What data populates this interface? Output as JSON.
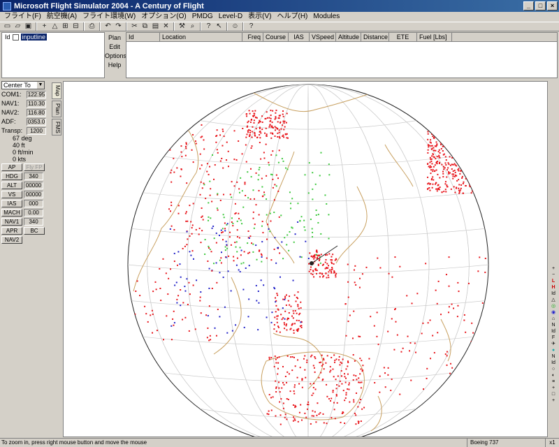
{
  "window": {
    "title": "Microsoft Flight Simulator 2004 - A Century of Flight",
    "min": "_",
    "max": "□",
    "close": "×"
  },
  "menu": [
    "フライト(F)",
    "航空機(A)",
    "フライト環境(W)",
    "オプション(O)",
    "PMDG",
    "Level-D",
    "表示(V)",
    "ヘルプ(H)",
    "Modules"
  ],
  "toplist": {
    "id_label": "Id",
    "input_value": "inputline"
  },
  "planmenu": [
    "Plan",
    "Edit",
    "Options",
    "Help"
  ],
  "flightplan": {
    "columns": [
      "Id",
      "Location",
      "Freq",
      "Course",
      "IAS",
      "VSpeed",
      "Altitude",
      "Distance",
      "ETE",
      "Fuel [Lbs]"
    ]
  },
  "sidebar": {
    "center_to": "Center To",
    "radios": [
      {
        "label": "COM1:",
        "value": "122.95"
      },
      {
        "label": "NAV1:",
        "value": "110.30"
      },
      {
        "label": "NAV2:",
        "value": "116.80"
      },
      {
        "label": "ADF:",
        "value": "0353.0"
      },
      {
        "label": "Transp:",
        "value": "1200"
      }
    ],
    "info": [
      "67 deg",
      "40 ft",
      "0 ft/min",
      "0 kts"
    ],
    "ap": [
      {
        "btn": "AP",
        "val": "Fly FP"
      },
      {
        "btn": "HDG",
        "val": "340"
      },
      {
        "btn": "ALT",
        "val": "00000"
      },
      {
        "btn": "VS",
        "val": "00000"
      },
      {
        "btn": "IAS",
        "val": "000"
      },
      {
        "btn": "MACH",
        "val": "0.00"
      },
      {
        "btn": "NAV1",
        "val": "340"
      },
      {
        "btn": "APR",
        "val": "BC"
      },
      {
        "btn": "NAV2",
        "val": ""
      }
    ]
  },
  "tabs": [
    "Map",
    "Plan",
    "FMS"
  ],
  "righttools": [
    "+",
    "−",
    "L",
    "H",
    "Id",
    "△",
    "◎",
    "◉",
    "⌂",
    "N",
    "Id",
    "F",
    "✈",
    "●",
    "N",
    "Id",
    "○",
    "◐",
    "≡",
    "+",
    "□",
    "+"
  ],
  "status": {
    "hint": "To zoom in, press right mouse button and move the mouse",
    "aircraft": "Boeing 737",
    "zoom": "x1"
  },
  "colors": {
    "title_start": "#0a246a",
    "airport_red": "#e8141a",
    "coast": "#c8a060",
    "vor_green": "#3cc83c",
    "ndb_blue": "#2020c8"
  }
}
